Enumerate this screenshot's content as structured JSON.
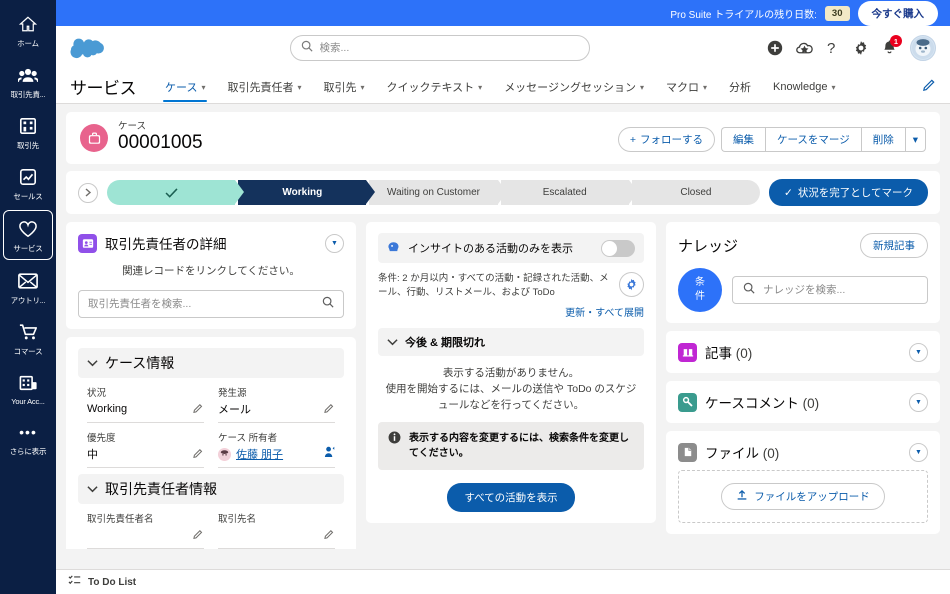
{
  "app_rail": {
    "items": [
      {
        "label": "ホーム",
        "icon": "home-icon",
        "selected": false
      },
      {
        "label": "取引先責...",
        "icon": "contacts-icon",
        "selected": false
      },
      {
        "label": "取引先",
        "icon": "accounts-icon",
        "selected": false
      },
      {
        "label": "セールス",
        "icon": "sales-chart-icon",
        "selected": false
      },
      {
        "label": "サービス",
        "icon": "service-heart-icon",
        "selected": true
      },
      {
        "label": "アウトリ...",
        "icon": "outreach-envelope-icon",
        "selected": false
      },
      {
        "label": "コマース",
        "icon": "commerce-cart-icon",
        "selected": false
      },
      {
        "label": "Your Acc...",
        "icon": "your-account-icon",
        "selected": false
      },
      {
        "label": "さらに表示",
        "icon": "more-dots-icon",
        "selected": false
      }
    ]
  },
  "trial_banner": {
    "text": "Pro Suite トライアルの残り日数:",
    "days": "30",
    "buy_label": "今すぐ購入"
  },
  "global_header": {
    "logo": "salesforce-cloud-logo",
    "search_placeholder": "検索...",
    "search_value": "",
    "icons": [
      "plus-icon",
      "favorites-cloud-icon",
      "help-question-icon",
      "setup-gear-icon",
      "notifications-bell-icon"
    ],
    "notification_count": "1",
    "avatar": "user-avatar"
  },
  "app_nav": {
    "app_name": "サービス",
    "tabs": [
      {
        "label": "ケース",
        "has_caret": true,
        "active": true
      },
      {
        "label": "取引先責任者",
        "has_caret": true,
        "active": false
      },
      {
        "label": "取引先",
        "has_caret": true,
        "active": false
      },
      {
        "label": "クイックテキスト",
        "has_caret": true,
        "active": false
      },
      {
        "label": "メッセージングセッション",
        "has_caret": true,
        "active": false
      },
      {
        "label": "マクロ",
        "has_caret": true,
        "active": false
      },
      {
        "label": "分析",
        "has_caret": false,
        "active": false
      },
      {
        "label": "Knowledge",
        "has_caret": true,
        "active": false
      }
    ],
    "edit_icon": "pencil-icon"
  },
  "record_header": {
    "object_label": "ケース",
    "record_number": "00001005",
    "icon": "case-briefcase-icon",
    "follow_label": "フォローする",
    "edit_label": "編集",
    "merge_label": "ケースをマージ",
    "delete_label": "削除",
    "more_label": "▾"
  },
  "path": {
    "toggle_icon": "chevron-right-icon",
    "steps": [
      {
        "label": "",
        "state": "done"
      },
      {
        "label": "Working",
        "state": "current"
      },
      {
        "label": "Waiting on Customer",
        "state": "upcoming"
      },
      {
        "label": "Escalated",
        "state": "upcoming"
      },
      {
        "label": "Closed",
        "state": "upcoming"
      }
    ],
    "complete_label": "状況を完了としてマーク"
  },
  "contact_details_card": {
    "title": "取引先責任者の詳細",
    "icon": "contact-card-icon",
    "hint": "関連レコードをリンクしてください。",
    "search_placeholder": "取引先責任者を検索...",
    "search_value": ""
  },
  "case_info": {
    "section_title": "ケース情報",
    "fields": [
      {
        "label": "状況",
        "value": "Working",
        "type": "text"
      },
      {
        "label": "発生源",
        "value": "メール",
        "type": "text"
      },
      {
        "label": "優先度",
        "value": "中",
        "type": "text"
      },
      {
        "label": "ケース 所有者",
        "value": "佐藤 朋子",
        "type": "link"
      }
    ]
  },
  "contact_info": {
    "section_title": "取引先責任者情報",
    "fields": [
      {
        "label": "取引先責任者名",
        "value": ""
      },
      {
        "label": "取引先名",
        "value": ""
      }
    ]
  },
  "activity": {
    "insight_toggle_label": "インサイトのある活動のみを表示",
    "insight_toggle_on": false,
    "insight_icon": "einstein-insight-icon",
    "filter_text": "条件: 2 か月以内・すべての活動・記録された活動、メール、行動、リストメール、および ToDo",
    "filter_gear_icon": "gear-icon",
    "refresh_label": "更新",
    "separator": "・",
    "expand_all_label": "すべて展開",
    "section_title": "今後 & 期限切れ",
    "empty_line1": "表示する活動がありません。",
    "empty_line2": "使用を開始するには、メールの送信や ToDo のスケジュールなどを行ってください。",
    "info_text": "表示する内容を変更するには、検索条件を変更してください。",
    "show_all_label": "すべての活動を表示"
  },
  "knowledge": {
    "title": "ナレッジ",
    "new_article_label": "新規記事",
    "filter_label_line1": "条",
    "filter_label_line2": "件",
    "search_placeholder": "ナレッジを検索...",
    "search_value": ""
  },
  "related_cards": [
    {
      "title": "記事",
      "count": "(0)",
      "icon": "article-icon",
      "color": "#c026d3"
    },
    {
      "title": "ケースコメント",
      "count": "(0)",
      "icon": "case-comment-icon",
      "color": "#3a9b8e"
    },
    {
      "title": "ファイル",
      "count": "(0)",
      "icon": "file-icon",
      "color": "#8c8c8c"
    }
  ],
  "files_card": {
    "upload_label": "ファイルをアップロード",
    "upload_icon": "upload-icon"
  },
  "utility_bar": {
    "todo_label": "To Do List",
    "todo_icon": "todo-list-icon"
  },
  "colors": {
    "brand_blue": "#0b5cab",
    "banner_blue": "#2d72f9",
    "rail_navy": "#0b1f44",
    "path_current": "#14325c",
    "path_done": "#9ee4d4",
    "case_pink": "#e8638d",
    "badge_red": "#ea001e"
  }
}
